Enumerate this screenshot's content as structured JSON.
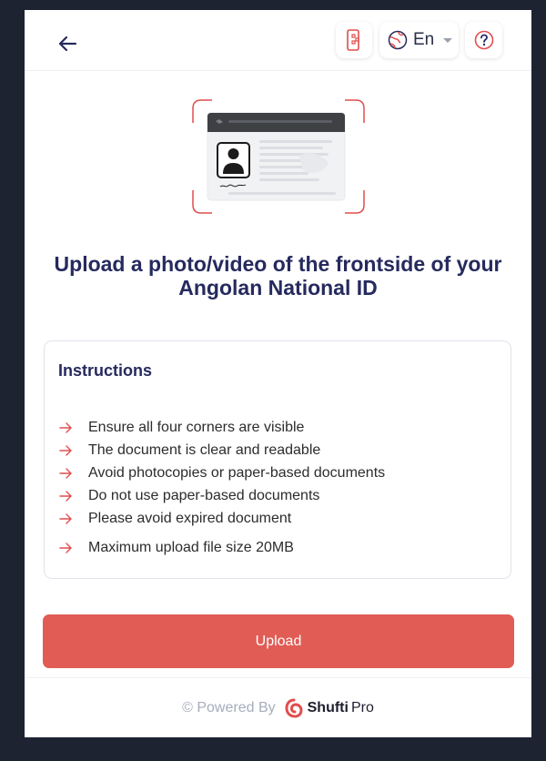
{
  "header": {
    "language": "En"
  },
  "main": {
    "title": "Upload a photo/video of the frontside of your Angolan National ID"
  },
  "instructions": {
    "title": "Instructions",
    "items": [
      "Ensure all four corners are visible",
      "The document is clear and readable",
      "Avoid photocopies or paper-based documents",
      "Do not use paper-based documents",
      "Please avoid expired document",
      "Maximum upload file size 20MB"
    ]
  },
  "actions": {
    "upload_label": "Upload"
  },
  "footer": {
    "powered_by": "© Powered By",
    "brand_part1": "Shufti",
    "brand_part2": "Pro"
  },
  "colors": {
    "accent": "#e05c55",
    "heading": "#262a5e",
    "background": "#1d2331"
  }
}
